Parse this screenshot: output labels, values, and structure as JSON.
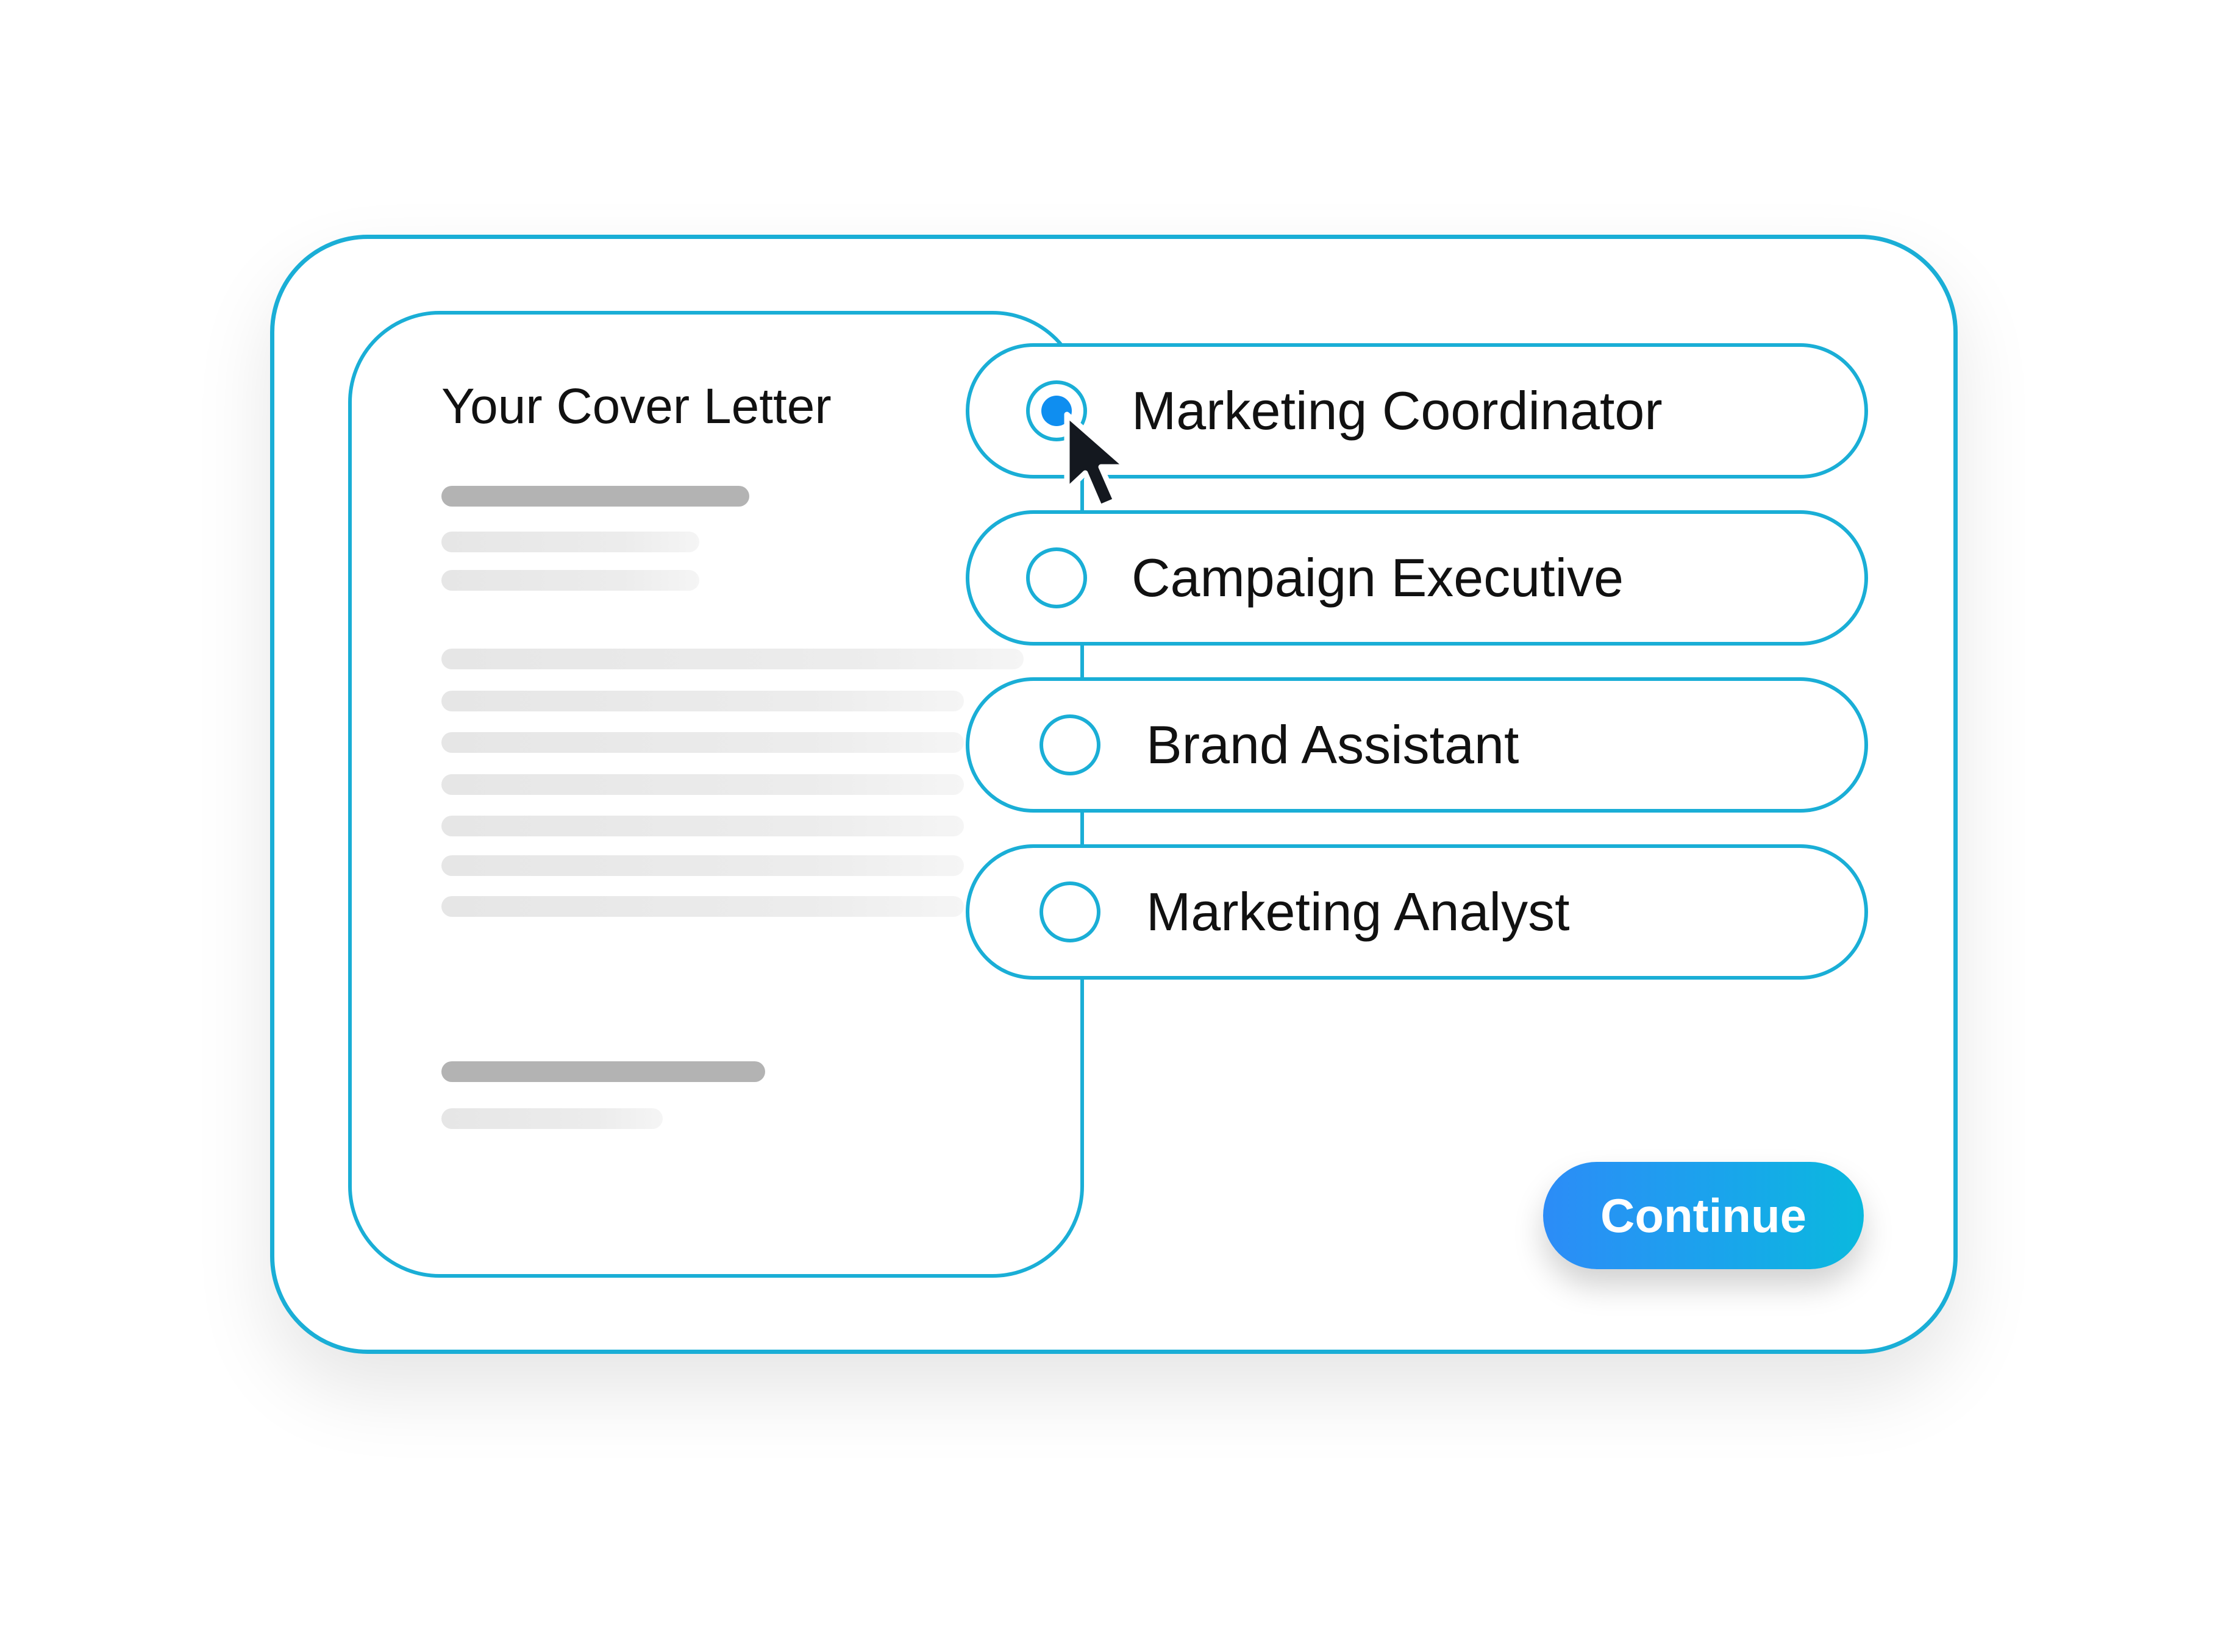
{
  "cover_letter": {
    "title": "Your Cover Letter"
  },
  "options": [
    {
      "label": "Marketing Coordinator",
      "selected": true
    },
    {
      "label": "Campaign Executive",
      "selected": false
    },
    {
      "label": "Brand Assistant",
      "selected": false
    },
    {
      "label": "Marketing Analyst",
      "selected": false
    }
  ],
  "continue_label": "Continue",
  "colors": {
    "accent": "#1aaed6",
    "selected_dot": "#0f8ef0",
    "button_start": "#2c8cf7",
    "button_end": "#0ab9de"
  },
  "icons": {
    "cursor": "mouse-pointer-icon"
  }
}
